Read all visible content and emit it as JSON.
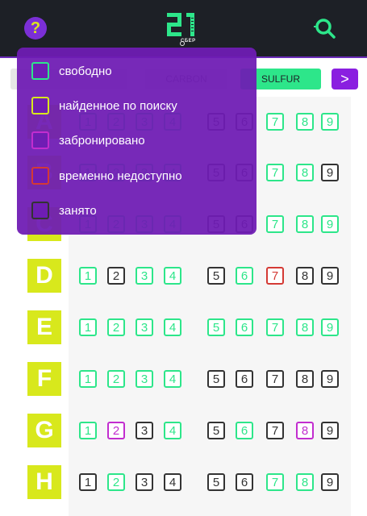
{
  "header": {
    "help_symbol": "?",
    "logo_text": "21",
    "logo_caption": "СБЕР"
  },
  "filters": [
    {
      "label": "",
      "style": "neutral"
    },
    {
      "label": "CARBON",
      "style": "neutral"
    },
    {
      "label": "SULFUR",
      "style": "active"
    },
    {
      "label": ">",
      "style": "next"
    }
  ],
  "rows": [
    {
      "label": "A",
      "seats": [
        [
          "1",
          "free"
        ],
        [
          "2",
          "free"
        ],
        [
          "3",
          "free"
        ],
        [
          "4",
          "free"
        ],
        [
          "5",
          "busy"
        ],
        [
          "6",
          "busy"
        ],
        [
          "7",
          "free"
        ],
        [
          "8",
          "free"
        ],
        [
          "9",
          "free"
        ]
      ]
    },
    {
      "label": "B",
      "seats": [
        [
          "1",
          "free"
        ],
        [
          "2",
          "free"
        ],
        [
          "3",
          "free"
        ],
        [
          "4",
          "free"
        ],
        [
          "5",
          "busy"
        ],
        [
          "6",
          "busy"
        ],
        [
          "7",
          "free"
        ],
        [
          "8",
          "free"
        ],
        [
          "9",
          "busy"
        ]
      ]
    },
    {
      "label": "C",
      "seats": [
        [
          "1",
          "free"
        ],
        [
          "2",
          "free"
        ],
        [
          "3",
          "free"
        ],
        [
          "4",
          "free"
        ],
        [
          "5",
          "busy"
        ],
        [
          "6",
          "busy"
        ],
        [
          "7",
          "free"
        ],
        [
          "8",
          "free"
        ],
        [
          "9",
          "free"
        ]
      ]
    },
    {
      "label": "D",
      "seats": [
        [
          "1",
          "free"
        ],
        [
          "2",
          "busy"
        ],
        [
          "3",
          "free"
        ],
        [
          "4",
          "free"
        ],
        [
          "5",
          "busy"
        ],
        [
          "6",
          "free"
        ],
        [
          "7",
          "na"
        ],
        [
          "8",
          "busy"
        ],
        [
          "9",
          "busy"
        ]
      ]
    },
    {
      "label": "E",
      "seats": [
        [
          "1",
          "free"
        ],
        [
          "2",
          "free"
        ],
        [
          "3",
          "free"
        ],
        [
          "4",
          "free"
        ],
        [
          "5",
          "free"
        ],
        [
          "6",
          "free"
        ],
        [
          "7",
          "free"
        ],
        [
          "8",
          "free"
        ],
        [
          "9",
          "free"
        ]
      ]
    },
    {
      "label": "F",
      "seats": [
        [
          "1",
          "free"
        ],
        [
          "2",
          "free"
        ],
        [
          "3",
          "free"
        ],
        [
          "4",
          "free"
        ],
        [
          "5",
          "busy"
        ],
        [
          "6",
          "busy"
        ],
        [
          "7",
          "busy"
        ],
        [
          "8",
          "busy"
        ],
        [
          "9",
          "busy"
        ]
      ]
    },
    {
      "label": "G",
      "seats": [
        [
          "1",
          "free"
        ],
        [
          "2",
          "book"
        ],
        [
          "3",
          "busy"
        ],
        [
          "4",
          "free"
        ],
        [
          "5",
          "busy"
        ],
        [
          "6",
          "free"
        ],
        [
          "7",
          "busy"
        ],
        [
          "8",
          "book"
        ],
        [
          "9",
          "busy"
        ]
      ]
    },
    {
      "label": "H",
      "seats": [
        [
          "1",
          "busy"
        ],
        [
          "2",
          "free"
        ],
        [
          "3",
          "busy"
        ],
        [
          "4",
          "busy"
        ],
        [
          "5",
          "busy"
        ],
        [
          "6",
          "busy"
        ],
        [
          "7",
          "free"
        ],
        [
          "8",
          "free"
        ],
        [
          "9",
          "busy"
        ]
      ]
    }
  ],
  "legend": [
    {
      "label": "свободно",
      "color": "#2de68a"
    },
    {
      "label": "найденное по поиску",
      "color": "#d8e81c"
    },
    {
      "label": "забронировано",
      "color": "#c22dcf"
    },
    {
      "label": "временно недоступно",
      "color": "#d43a35"
    },
    {
      "label": "занято",
      "color": "#333333"
    }
  ],
  "colors": {
    "free": "#2de68a",
    "busy": "#333333",
    "na": "#d43a35",
    "book": "#c22dcf",
    "accent": "#7b2fd6",
    "row_label": "#d8e81c"
  }
}
